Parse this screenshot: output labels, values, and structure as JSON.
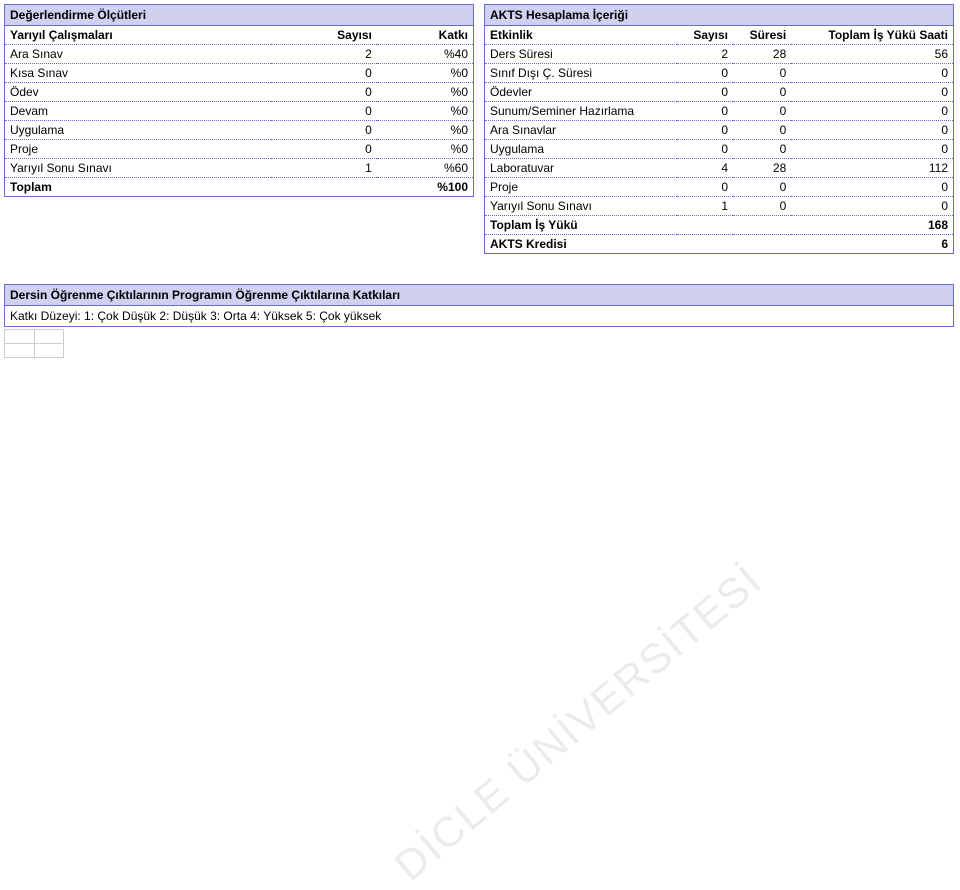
{
  "left": {
    "title": "Değerlendirme Ölçütleri",
    "header": {
      "c1": "Yarıyıl Çalışmaları",
      "c2": "Sayısı",
      "c3": "Katkı"
    },
    "rows": [
      {
        "name": "Ara Sınav",
        "count": "2",
        "weight": "%40"
      },
      {
        "name": "Kısa Sınav",
        "count": "0",
        "weight": "%0"
      },
      {
        "name": "Ödev",
        "count": "0",
        "weight": "%0"
      },
      {
        "name": "Devam",
        "count": "0",
        "weight": "%0"
      },
      {
        "name": "Uygulama",
        "count": "0",
        "weight": "%0"
      },
      {
        "name": "Proje",
        "count": "0",
        "weight": "%0"
      },
      {
        "name": "Yarıyıl Sonu Sınavı",
        "count": "1",
        "weight": "%60"
      }
    ],
    "total": {
      "name": "Toplam",
      "weight": "%100"
    }
  },
  "right": {
    "title": "AKTS Hesaplama İçeriği",
    "header": {
      "c1": "Etkinlik",
      "c2": "Sayısı",
      "c3": "Süresi",
      "c4": "Toplam İş Yükü Saati"
    },
    "rows": [
      {
        "name": "Ders Süresi",
        "count": "2",
        "dur": "28",
        "total": "56"
      },
      {
        "name": "Sınıf Dışı Ç. Süresi",
        "count": "0",
        "dur": "0",
        "total": "0"
      },
      {
        "name": "Ödevler",
        "count": "0",
        "dur": "0",
        "total": "0"
      },
      {
        "name": "Sunum/Seminer Hazırlama",
        "count": "0",
        "dur": "0",
        "total": "0"
      },
      {
        "name": "Ara Sınavlar",
        "count": "0",
        "dur": "0",
        "total": "0"
      },
      {
        "name": "Uygulama",
        "count": "0",
        "dur": "0",
        "total": "0"
      },
      {
        "name": "Laboratuvar",
        "count": "4",
        "dur": "28",
        "total": "112"
      },
      {
        "name": "Proje",
        "count": "0",
        "dur": "0",
        "total": "0"
      },
      {
        "name": "Yarıyıl Sonu Sınavı",
        "count": "1",
        "dur": "0",
        "total": "0"
      }
    ],
    "total1": {
      "name": "Toplam İş Yükü",
      "value": "168"
    },
    "total2": {
      "name": "AKTS Kredisi",
      "value": "6"
    }
  },
  "bottom": {
    "title": "Dersin Öğrenme Çıktılarının Programın Öğrenme Çıktılarına Katkıları",
    "legend": "Katkı Düzeyi: 1: Çok Düşük 2: Düşük 3: Orta 4: Yüksek 5: Çok yüksek"
  },
  "watermark": "DİCLE ÜNİVERSİTESİ"
}
